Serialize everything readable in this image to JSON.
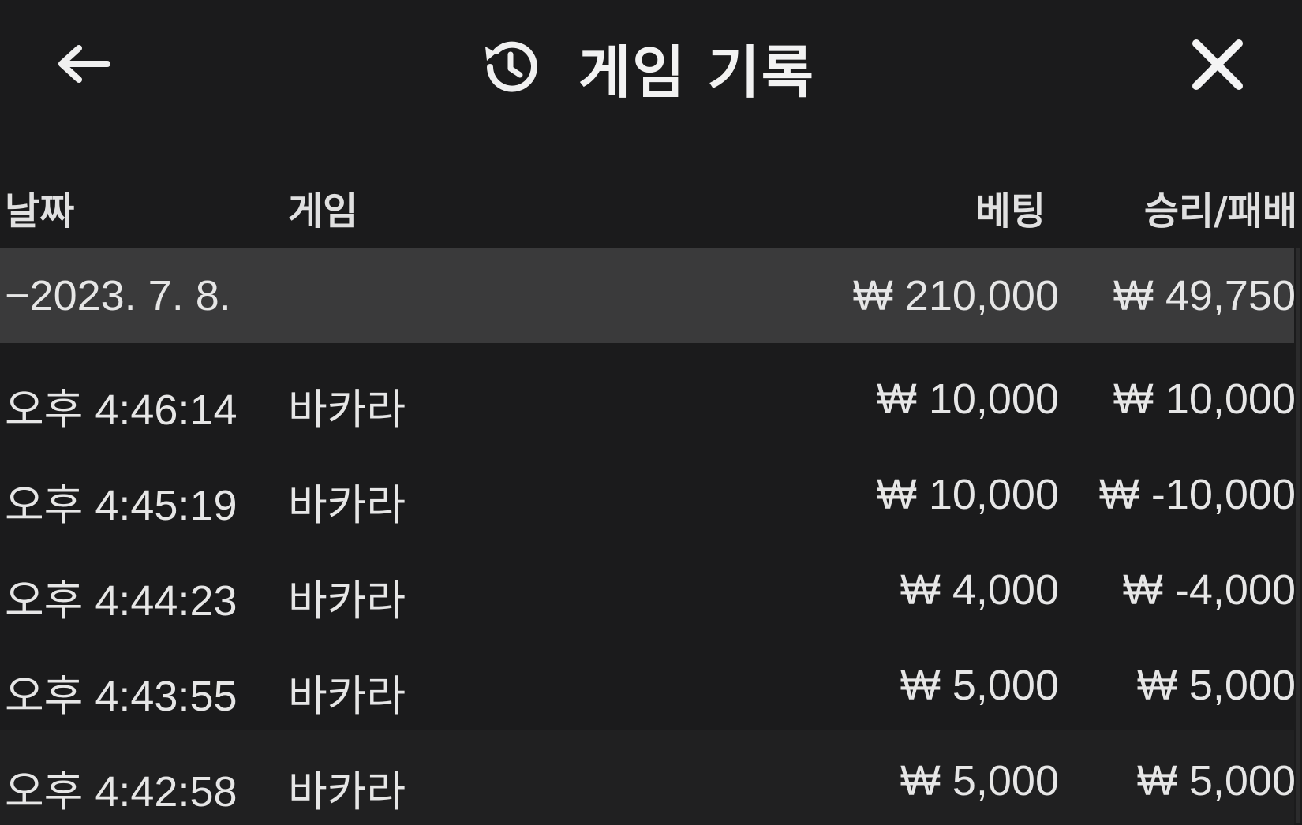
{
  "header": {
    "title": "게임 기록",
    "back_icon": "arrow-left-icon",
    "history_icon": "history-clock-icon",
    "close_icon": "close-x-icon"
  },
  "columns": {
    "date": "날짜",
    "game": "게임",
    "bet": "베팅",
    "result": "승리/패배"
  },
  "summary": {
    "date": "−2023. 7. 8.",
    "bet": "₩ 210,000",
    "result": "₩ 49,750"
  },
  "rows": [
    {
      "time": "오후 4:46:14",
      "game": "바카라",
      "bet": "₩ 10,000",
      "result": "₩ 10,000"
    },
    {
      "time": "오후 4:45:19",
      "game": "바카라",
      "bet": "₩ 10,000",
      "result": "₩ -10,000"
    },
    {
      "time": "오후 4:44:23",
      "game": "바카라",
      "bet": "₩ 4,000",
      "result": "₩ -4,000"
    },
    {
      "time": "오후 4:43:55",
      "game": "바카라",
      "bet": "₩ 5,000",
      "result": "₩ 5,000"
    },
    {
      "time": "오후 4:42:58",
      "game": "바카라",
      "bet": "₩ 5,000",
      "result": "₩ 5,000"
    }
  ],
  "colors": {
    "background": "#1b1b1c",
    "summary_row": "#3a3a3b",
    "text": "#e6e6e6"
  }
}
